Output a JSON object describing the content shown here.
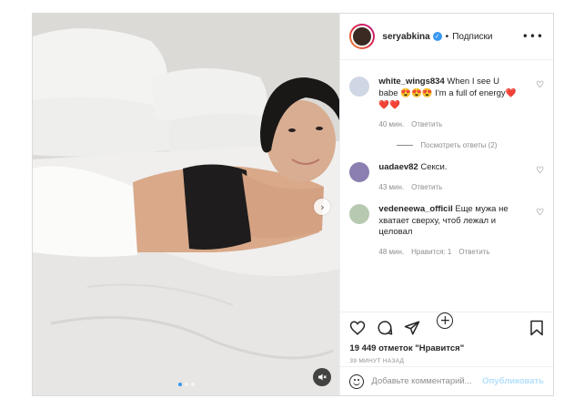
{
  "colors": {
    "accent": "#3897f0",
    "border": "#dbdbdb",
    "muted": "#8e8e8e",
    "publish_disabled": "#b2dffc"
  },
  "media": {
    "carousel_total": 3,
    "carousel_active": 1
  },
  "header": {
    "username": "seryabkina",
    "separator": "•",
    "follow_label": "Подписки",
    "more_icon": "more-horizontal-icon"
  },
  "comments": [
    {
      "username": "white_wings834",
      "text": " When I see U babe 😍😍😍 I'm a full of energy❤️❤️❤️",
      "time": "40 мин.",
      "reply": "Ответить",
      "likes": ""
    },
    {
      "username": "uadaev82",
      "text": " Секси.",
      "time": "43 мин.",
      "reply": "Ответить",
      "likes": ""
    },
    {
      "username": "vedeneewa_officil",
      "text": " Еще мужа не хватает сверху, чтоб лежал и целовал",
      "time": "48 мин.",
      "reply": "Ответить",
      "likes": "Нравится: 1"
    }
  ],
  "view_replies": "Посмотреть ответы (2)",
  "actions": {
    "likes_text": "19 449 отметок \"Нравится\"",
    "posted": "39 МИНУТ НАЗАД"
  },
  "add_comment": {
    "placeholder": "Добавьте комментарий...",
    "publish": "Опубликовать"
  }
}
